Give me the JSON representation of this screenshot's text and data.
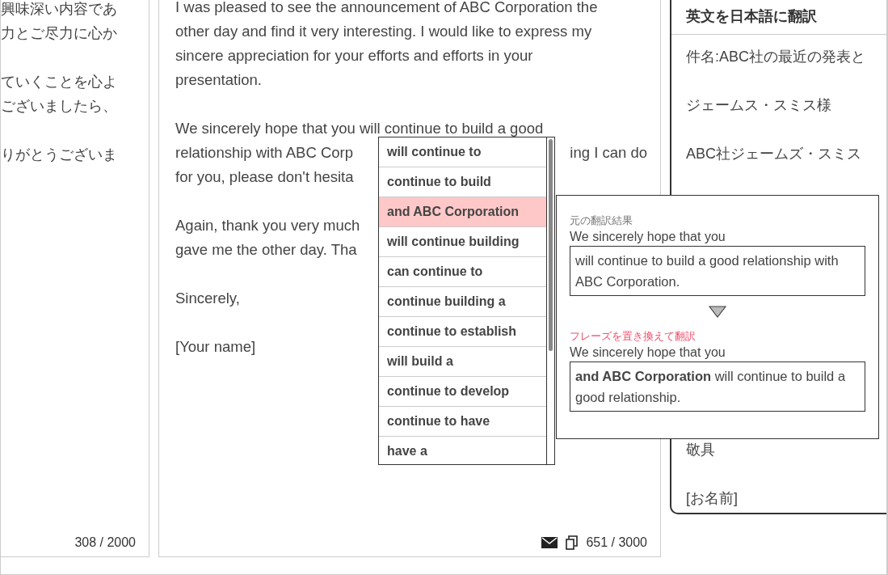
{
  "left_panel": {
    "paragraphs": [
      [
        "興味深い内容であ",
        "力とご尽力に心か"
      ],
      [
        "ていくことを心よ",
        "ございましたら、"
      ],
      [
        "りがとうございま"
      ]
    ],
    "counter": "308 / 2000"
  },
  "editor": {
    "paragraphs": [
      [
        [
          "I was pleased to see the announcement of ABC Corporation the"
        ],
        [
          "other day and find it very interesting. I would like to express my"
        ],
        [
          "sincere appreciation for your efforts and efforts in your"
        ],
        [
          "presentation."
        ]
      ],
      [
        [
          "We sincerely hope that you will continue to build a good"
        ],
        [
          "relationship with ABC Corp",
          "ing I can do"
        ],
        [
          "for you, please don't hesita"
        ]
      ],
      [
        [
          "Again, thank you very much"
        ],
        [
          "gave me the other day. Tha"
        ]
      ],
      [
        [
          "Sincerely,"
        ]
      ],
      [
        [
          "[Your name]"
        ]
      ]
    ],
    "counter": "651 / 3000"
  },
  "translation_panel": {
    "title": "英文を日本語に翻訳",
    "lines_top": [
      "件名:ABC社の最近の発表と",
      "ジェームス・スミス様",
      "ABC社ジェームズ・スミス"
    ],
    "lines_bottom": [
      "敬具",
      "[お名前]"
    ]
  },
  "suggestions": [
    {
      "text": "will continue to",
      "selected": false
    },
    {
      "text": "continue to build",
      "selected": false
    },
    {
      "text": "and ABC Corporation",
      "selected": true
    },
    {
      "text": "will continue building",
      "selected": false
    },
    {
      "text": "can continue to",
      "selected": false
    },
    {
      "text": "continue building a",
      "selected": false
    },
    {
      "text": "continue to establish",
      "selected": false
    },
    {
      "text": "will build a",
      "selected": false
    },
    {
      "text": "continue to develop",
      "selected": false
    },
    {
      "text": "continue to have",
      "selected": false
    },
    {
      "text": "have a",
      "selected": false
    }
  ],
  "comparison": {
    "original_label": "元の翻訳結果",
    "original_prefix": "We sincerely hope that you",
    "original_text": "will continue to build a good relationship with ABC Corporation.",
    "replaced_label": "フレーズを置き換えて翻訳",
    "replaced_prefix": "We sincerely hope that you",
    "replaced_text": "**and ABC Corporation** will continue to build a good relationship."
  }
}
